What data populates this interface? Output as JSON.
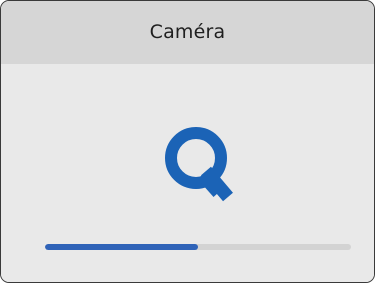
{
  "panel": {
    "title": "Caméra",
    "logo_icon": "q-logo-icon",
    "accent": "#1b63b6",
    "progress": {
      "value": 0.5,
      "fill_color": "#2f63b8",
      "track_color": "#d3d3d3"
    }
  }
}
